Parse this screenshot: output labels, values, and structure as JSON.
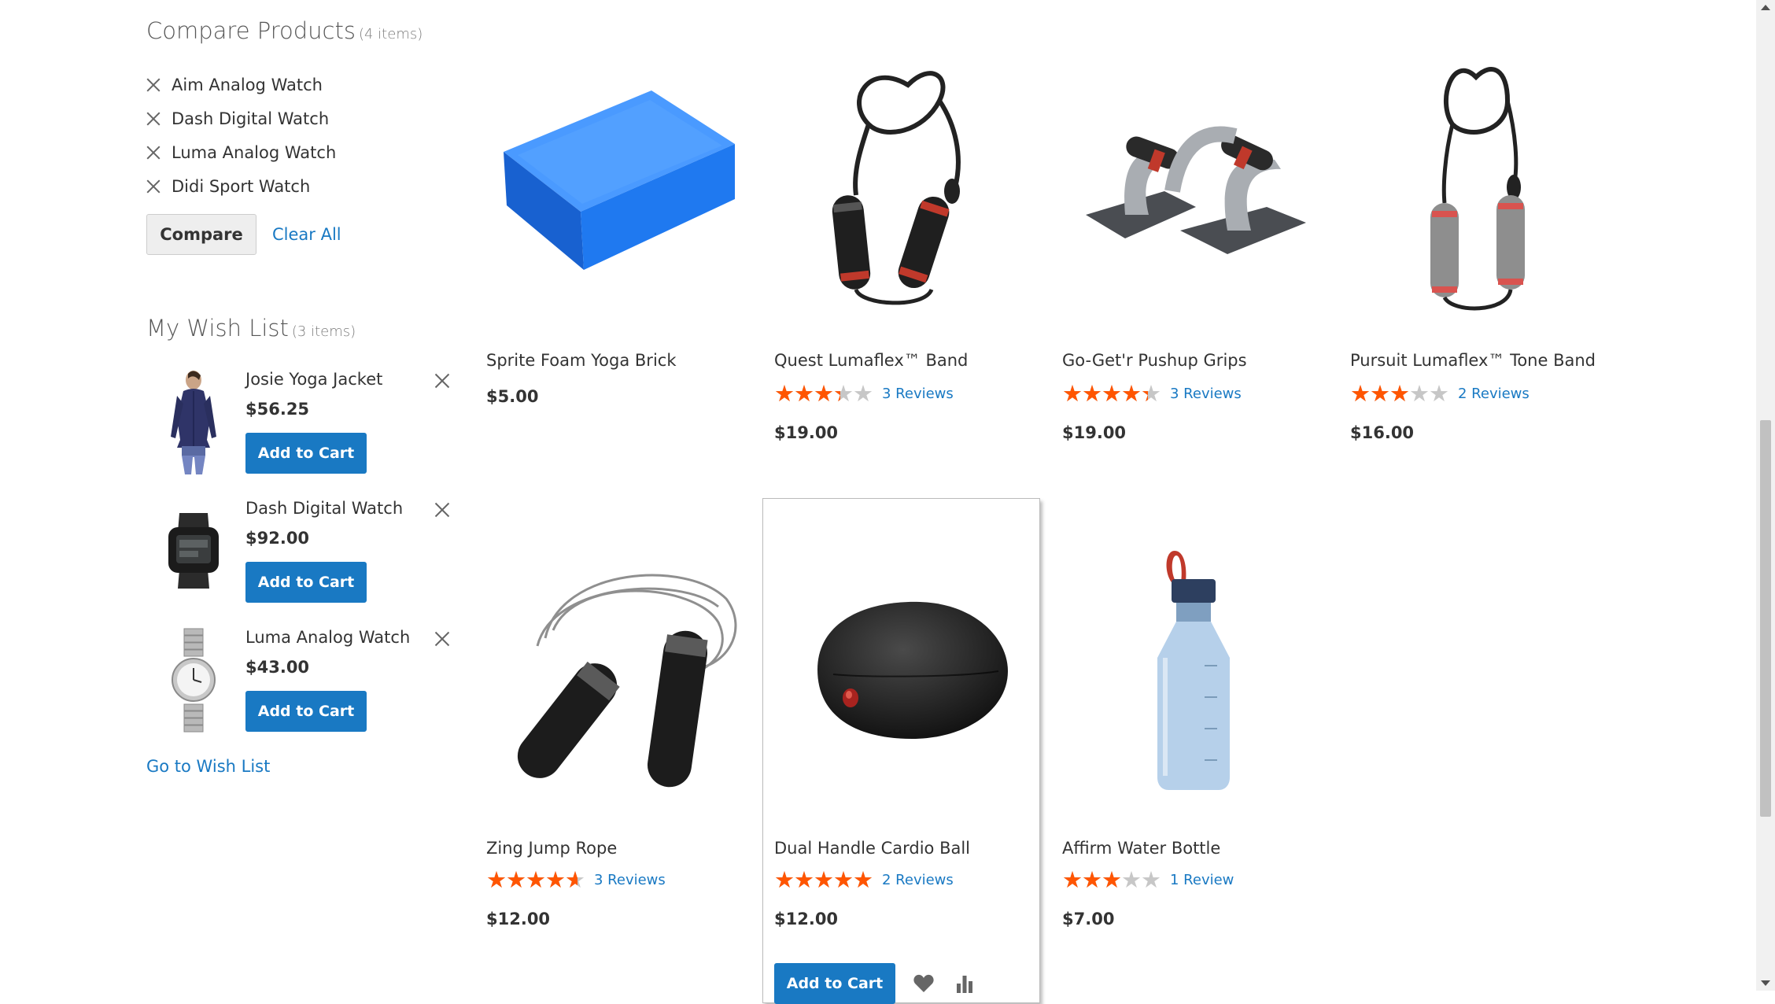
{
  "compare": {
    "title": "Compare Products",
    "count": "(4 items)",
    "items": [
      {
        "name": "Aim Analog Watch"
      },
      {
        "name": "Dash Digital Watch"
      },
      {
        "name": "Luma Analog Watch"
      },
      {
        "name": "Didi Sport Watch"
      }
    ],
    "compare_label": "Compare",
    "clear_label": "Clear All"
  },
  "wishlist": {
    "title": "My Wish List",
    "count": "(3 items)",
    "items": [
      {
        "name": "Josie Yoga Jacket",
        "price": "$56.25",
        "button": "Add to Cart",
        "icon": "jacket-image"
      },
      {
        "name": "Dash Digital Watch",
        "price": "$92.00",
        "button": "Add to Cart",
        "icon": "digital-watch-image"
      },
      {
        "name": "Luma Analog Watch",
        "price": "$43.00",
        "button": "Add to Cart",
        "icon": "analog-watch-image"
      }
    ],
    "goto_label": "Go to Wish List"
  },
  "products": [
    {
      "name": "Sprite Foam Yoga Brick",
      "price": "$5.00",
      "rating_percent": null,
      "reviews": null,
      "image": "yoga-brick"
    },
    {
      "name": "Quest Lumaflex™ Band",
      "price": "$19.00",
      "rating_percent": 67,
      "reviews": "3 Reviews",
      "image": "resistance-band"
    },
    {
      "name": "Go-Get'r Pushup Grips",
      "price": "$19.00",
      "rating_percent": 87,
      "reviews": "3 Reviews",
      "image": "pushup-grips"
    },
    {
      "name": "Pursuit Lumaflex™ Tone Band",
      "price": "$16.00",
      "rating_percent": 60,
      "reviews": "2 Reviews",
      "image": "tone-band"
    },
    {
      "name": "Zing Jump Rope",
      "price": "$12.00",
      "rating_percent": 93,
      "reviews": "3 Reviews",
      "image": "jump-rope"
    },
    {
      "name": "Dual Handle Cardio Ball",
      "price": "$12.00",
      "rating_percent": 100,
      "reviews": "2 Reviews",
      "image": "cardio-ball",
      "button": "Add to Cart"
    },
    {
      "name": "Affirm Water Bottle",
      "price": "$7.00",
      "rating_percent": 60,
      "reviews": "1 Review",
      "image": "water-bottle"
    }
  ],
  "colors": {
    "accent": "#1979c3",
    "star": "#ff5501",
    "star_empty": "#c7c7c7"
  }
}
